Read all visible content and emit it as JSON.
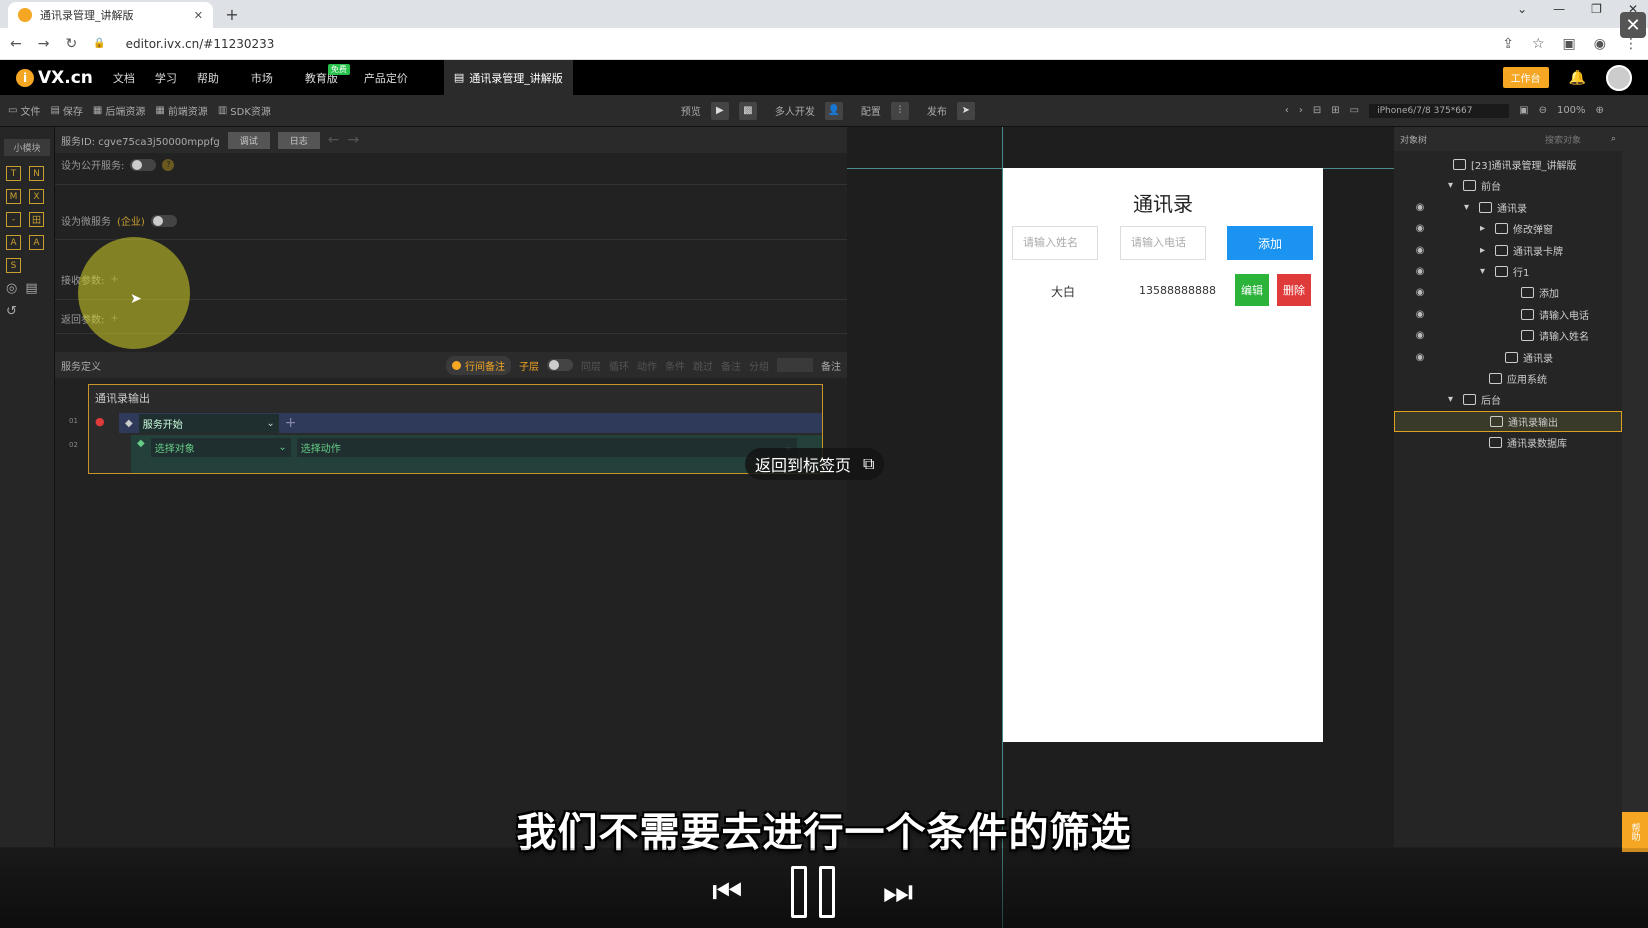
{
  "browser": {
    "tab_title": "通讯录管理_讲解版",
    "url": "editor.ivx.cn/#11230233"
  },
  "ivx": {
    "logo_text": "VX.cn",
    "nav": [
      "文档",
      "学习",
      "帮助",
      "市场",
      "教育版",
      "产品定价"
    ],
    "free_badge": "免费",
    "project_tab": "通讯录管理_讲解版",
    "workbench": "工作台"
  },
  "toolbar": {
    "left": [
      "文件",
      "保存",
      "后端资源",
      "前端资源",
      "SDK资源"
    ],
    "preview": "预览",
    "multi": "多人开发",
    "config": "配置",
    "publish": "发布",
    "device": "iPhone6/7/8 375*667",
    "zoom": "100%"
  },
  "rail": {
    "label": "小模块",
    "icons": [
      "T",
      "N",
      "M",
      "X",
      "-",
      "田",
      "A",
      "A",
      "S"
    ]
  },
  "service": {
    "id_label": "服务ID: cgve75ca3j50000mppfg",
    "debug": "调试",
    "log": "日志",
    "public_label": "设为公开服务:",
    "micro_label": "设为微服务",
    "micro_enterprise": "(企业)",
    "recv_label": "接收参数:",
    "return_label": "返回参数:",
    "def_label": "服务定义",
    "line_note": "行间备注",
    "sublayer": "子层",
    "same_layer": "同层",
    "dim_tabs": [
      "循环",
      "动作",
      "条件",
      "跳过",
      "备注",
      "分组"
    ],
    "remark": "备注"
  },
  "flow": {
    "title": "通讯录输出",
    "row1_num": "01",
    "row2_num": "02",
    "start": "服务开始",
    "select_obj": "选择对象",
    "select_action": "选择动作"
  },
  "phone": {
    "title": "通讯录",
    "name_placeholder": "请输入姓名",
    "phone_placeholder": "请输入电话",
    "add": "添加",
    "entry_name": "大白",
    "entry_phone": "13588888888",
    "edit": "编辑",
    "delete": "删除"
  },
  "overlay": {
    "return_tab": "返回到标签页",
    "subtitle": "我们不需要去进行一个条件的筛选"
  },
  "tree": {
    "header": "对象树",
    "search": "搜索对象",
    "nodes": [
      {
        "label": "[23]通讯录管理_讲解版"
      },
      {
        "label": "前台"
      },
      {
        "label": "通讯录"
      },
      {
        "label": "修改弹窗"
      },
      {
        "label": "通讯录卡牌"
      },
      {
        "label": "行1"
      },
      {
        "label": "添加"
      },
      {
        "label": "请输入电话"
      },
      {
        "label": "请输入姓名"
      },
      {
        "label": "通讯录"
      },
      {
        "label": "应用系统"
      },
      {
        "label": "后台"
      },
      {
        "label": "通讯录输出"
      },
      {
        "label": "通讯录数据库"
      }
    ],
    "help_badge": "帮助"
  },
  "colors": {
    "accent": "#f5a623",
    "add_blue": "#1a94f0",
    "edit_green": "#2bb33a",
    "delete_red": "#e03b3b"
  }
}
